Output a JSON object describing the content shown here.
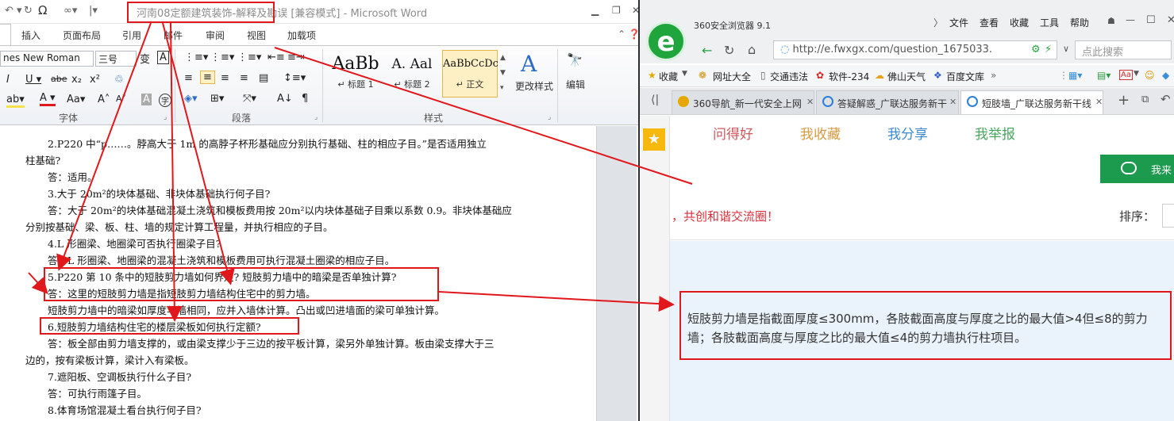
{
  "word": {
    "qat_icons": [
      "undo-icon",
      "redo-icon",
      "symbol-omega-icon",
      "format-painter-icon",
      "customize-qat-icon"
    ],
    "omega_label": "Ω",
    "title": "河南08定额建筑装饰-解释及勘误 [兼容模式] - Microsoft Word",
    "window_controls": [
      "minimize",
      "restore",
      "close"
    ],
    "tabs": [
      "插入",
      "页面布局",
      "引用",
      "邮件",
      "审阅",
      "视图",
      "加载项"
    ],
    "font_name": "nes New Roman",
    "font_size": "三号",
    "groups": {
      "font": "字体",
      "paragraph": "段落",
      "styles": "样式"
    },
    "styles": [
      {
        "preview": "AaBb",
        "name": "↵ 标题 1"
      },
      {
        "preview": "A. Aal",
        "name": "↵ 标题 2"
      },
      {
        "preview": "AaBbCcDc",
        "name": "↵ 正文"
      }
    ],
    "change_styles": "更改样式",
    "edit": "编辑",
    "doc_lines": [
      "2.P220 中“p……。脖高大于 1m 的高脖子杯形基础应分别执行基础、柱的相应子目。”是否适用独立",
      "柱基础?",
      "答：适用。",
      "3.大于 20m²的块体基础、非块体基础执行何子目?",
      "答：大于 20m²的块体基础混凝土浇筑和模板费用按 20m²以内块体基础子目乘以系数 0.9。非块体基础应",
      "分别按基础、梁、板、柱、墙的规定计算工程量，并执行相应的子目。",
      "4.L 形圈梁、地圈梁可否执行圈梁子目?",
      "答：L 形圈梁、地圈梁的混凝土浇筑和模板费用可执行混凝土圈梁的相应子目。",
      "5.P220 第 10 条中的短肢剪力墙如何界定? 短肢剪力墙中的暗梁是否单独计算?",
      "答：这里的短肢剪力墙是指短肢剪力墙结构住宅中的剪力墙。",
      "短肢剪力墙中的暗梁如厚度与墙相同，应并入墙体计算。凸出或凹进墙面的梁可单独计算。",
      "6.短肢剪力墙结构住宅的楼层梁板如何执行定额?",
      "答：板全部由剪力墙支撑的，或由梁支撑少于三边的按平板计算，梁另外单独计算。板由梁支撑大于三",
      "边的，按有梁板计算，梁计入有梁板。",
      "7.遮阳板、空调板执行什么子目?",
      "答：可执行雨篷子目。",
      "8.体育场馆混凝土看台执行何子目?"
    ]
  },
  "browser": {
    "name": "360安全浏览器 9.1",
    "logo_letter": "e",
    "menu": [
      "文件",
      "查看",
      "收藏",
      "工具",
      "帮助"
    ],
    "url": "http://e.fwxgx.com/question_1675033.",
    "search_placeholder": "点此搜索",
    "bookmarks": [
      "收藏",
      "网址大全",
      "交通违法",
      "软件-234",
      "佛山天气",
      "百度文库"
    ],
    "tabs": [
      {
        "title": "360导航_新一代安全上网",
        "active": false
      },
      {
        "title": "答疑解惑_广联达服务新干",
        "active": false
      },
      {
        "title": "短肢墙_广联达服务新干线",
        "active": true
      }
    ],
    "site_tabs": [
      {
        "label": "问得好",
        "color": "#d0575e"
      },
      {
        "label": "我收藏",
        "color": "#d89b42"
      },
      {
        "label": "我分享",
        "color": "#3e8ad0"
      },
      {
        "label": "我举报",
        "color": "#4aa55f"
      }
    ],
    "ask_button": "我来",
    "slogan": "，共创和谐交流圈！",
    "sort_label": "排序：",
    "answer": "短肢剪力墙是指截面厚度≤300mm，各肢截面高度与厚度之比的最大值>4但≤8的剪力墙；各肢截面高度与厚度之比的最大值≤4的剪力墙执行柱项目。"
  },
  "colors": {
    "annotation": "#e0181c",
    "word_title_text": "#8c8c8c",
    "browser_green": "#1c9a4d"
  }
}
